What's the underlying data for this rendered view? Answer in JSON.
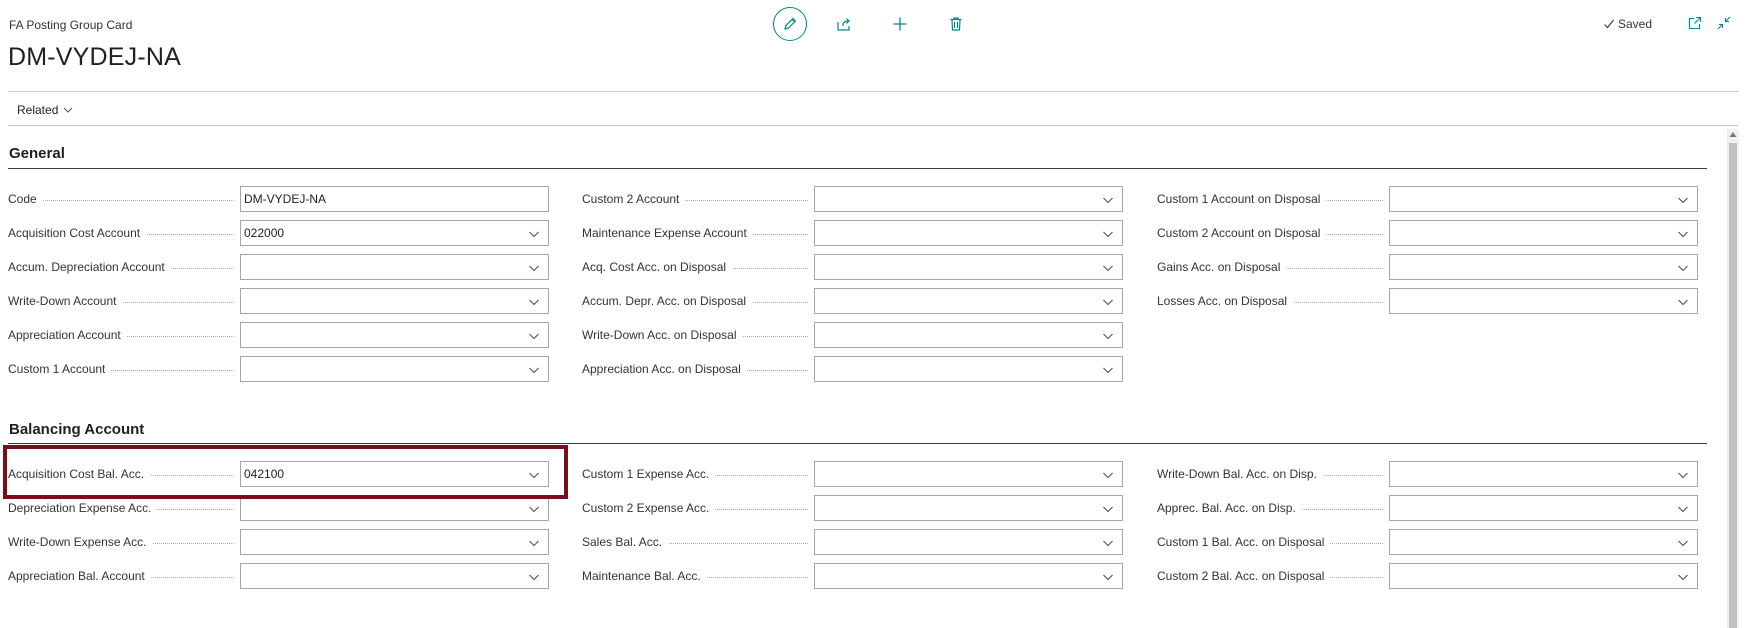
{
  "header": {
    "caption": "FA Posting Group Card",
    "title": "DM-VYDEJ-NA",
    "saved_label": "Saved",
    "toolbar_icons": [
      "edit-icon",
      "share-icon",
      "add-icon",
      "delete-icon"
    ]
  },
  "actions": {
    "related_label": "Related"
  },
  "colors": {
    "accent": "#00868a",
    "highlight": "#7a0e1d"
  },
  "general": {
    "title": "General",
    "columns": [
      [
        {
          "label": "Code",
          "value": "DM-VYDEJ-NA",
          "dropdown": false
        },
        {
          "label": "Acquisition Cost Account",
          "value": "022000",
          "dropdown": true
        },
        {
          "label": "Accum. Depreciation Account",
          "value": "",
          "dropdown": true
        },
        {
          "label": "Write-Down Account",
          "value": "",
          "dropdown": true
        },
        {
          "label": "Appreciation Account",
          "value": "",
          "dropdown": true
        },
        {
          "label": "Custom 1 Account",
          "value": "",
          "dropdown": true
        }
      ],
      [
        {
          "label": "Custom 2 Account",
          "value": "",
          "dropdown": true
        },
        {
          "label": "Maintenance Expense Account",
          "value": "",
          "dropdown": true
        },
        {
          "label": "Acq. Cost Acc. on Disposal",
          "value": "",
          "dropdown": true
        },
        {
          "label": "Accum. Depr. Acc. on Disposal",
          "value": "",
          "dropdown": true
        },
        {
          "label": "Write-Down Acc. on Disposal",
          "value": "",
          "dropdown": true
        },
        {
          "label": "Appreciation Acc. on Disposal",
          "value": "",
          "dropdown": true
        }
      ],
      [
        {
          "label": "Custom 1 Account on Disposal",
          "value": "",
          "dropdown": true
        },
        {
          "label": "Custom 2 Account on Disposal",
          "value": "",
          "dropdown": true
        },
        {
          "label": "Gains Acc. on Disposal",
          "value": "",
          "dropdown": true
        },
        {
          "label": "Losses Acc. on Disposal",
          "value": "",
          "dropdown": true
        }
      ]
    ]
  },
  "balancing": {
    "title": "Balancing Account",
    "columns": [
      [
        {
          "label": "Acquisition Cost Bal. Acc.",
          "value": "042100",
          "dropdown": true
        },
        {
          "label": "Depreciation Expense Acc.",
          "value": "",
          "dropdown": true
        },
        {
          "label": "Write-Down Expense Acc.",
          "value": "",
          "dropdown": true
        },
        {
          "label": "Appreciation Bal. Account",
          "value": "",
          "dropdown": true
        }
      ],
      [
        {
          "label": "Custom 1 Expense Acc.",
          "value": "",
          "dropdown": true
        },
        {
          "label": "Custom 2 Expense Acc.",
          "value": "",
          "dropdown": true
        },
        {
          "label": "Sales Bal. Acc.",
          "value": "",
          "dropdown": true
        },
        {
          "label": "Maintenance Bal. Acc.",
          "value": "",
          "dropdown": true
        }
      ],
      [
        {
          "label": "Write-Down Bal. Acc. on Disp.",
          "value": "",
          "dropdown": true
        },
        {
          "label": "Apprec. Bal. Acc. on Disp.",
          "value": "",
          "dropdown": true
        },
        {
          "label": "Custom 1 Bal. Acc. on Disposal",
          "value": "",
          "dropdown": true
        },
        {
          "label": "Custom 2 Bal. Acc. on Disposal",
          "value": "",
          "dropdown": true
        }
      ]
    ]
  }
}
